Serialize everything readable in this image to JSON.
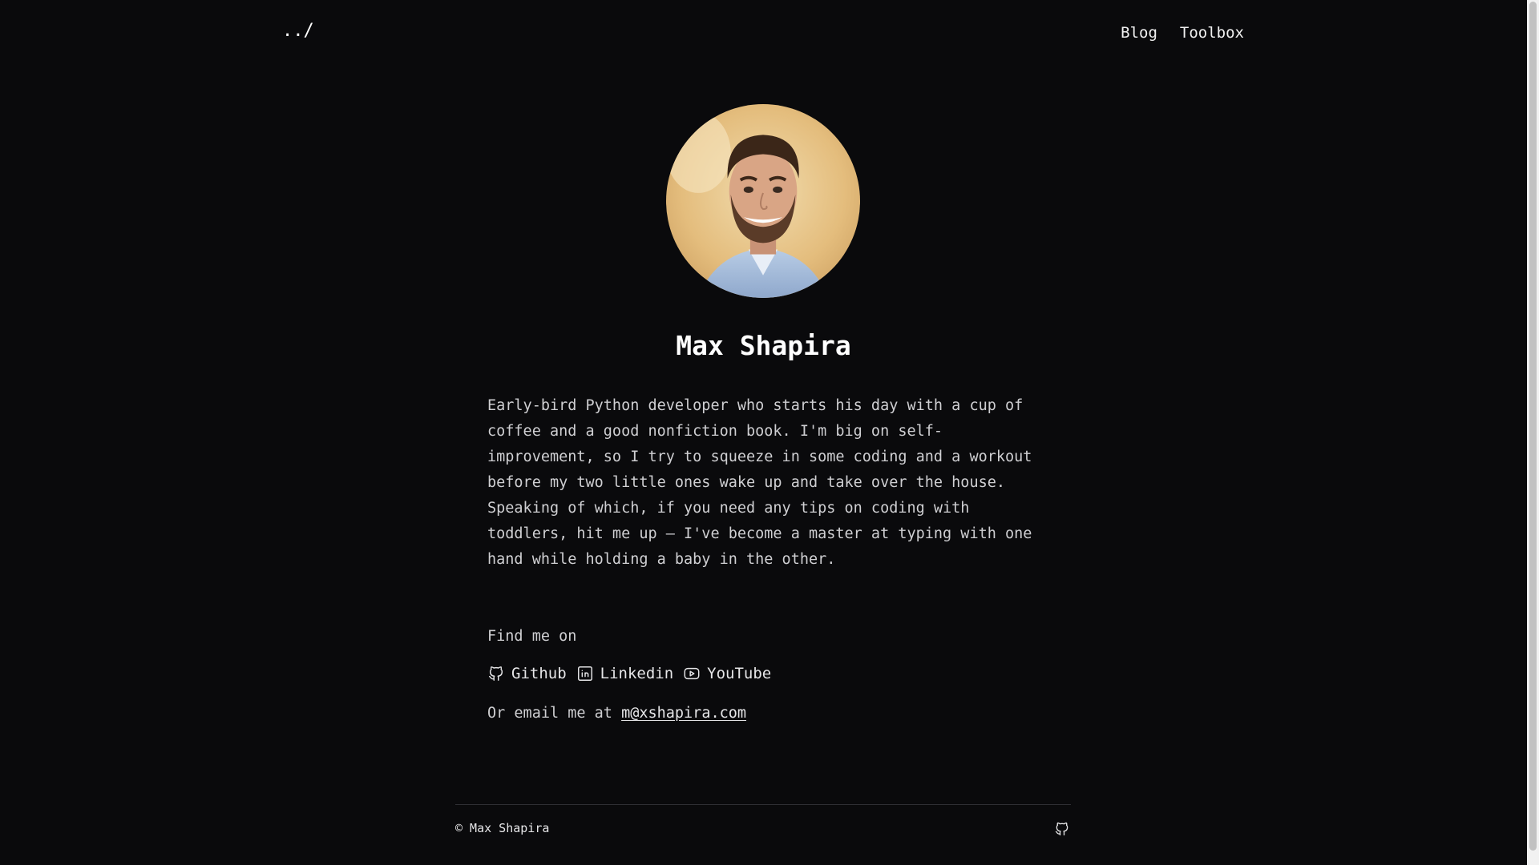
{
  "header": {
    "home_label": "../",
    "nav": [
      {
        "label": "Blog"
      },
      {
        "label": "Toolbox"
      }
    ]
  },
  "profile": {
    "name": "Max Shapira",
    "bio": "Early-bird Python developer who starts his day with a cup of coffee and a good nonfiction book. I'm big on self-improvement, so I try to squeeze in some coding and a workout before my two little ones wake up and take over the house. Speaking of which, if you need any tips on coding with toddlers, hit me up – I've become a master at typing with one hand while holding a baby in the other."
  },
  "contact": {
    "find_label": "Find me on",
    "links": [
      {
        "label": "Github",
        "icon": "github-icon"
      },
      {
        "label": "Linkedin",
        "icon": "linkedin-icon"
      },
      {
        "label": "YouTube",
        "icon": "youtube-icon"
      }
    ],
    "email_prefix": "Or email me at",
    "email": "m@xshapira.com"
  },
  "footer": {
    "copyright": "© Max Shapira",
    "icon": "github-icon"
  }
}
